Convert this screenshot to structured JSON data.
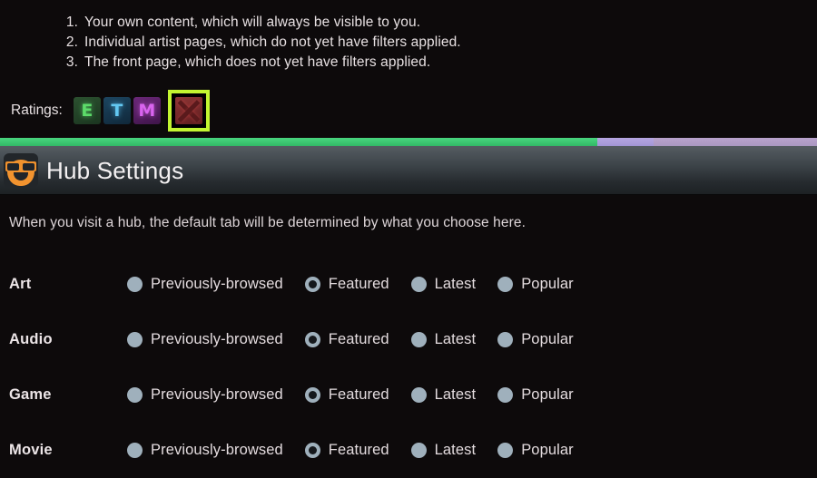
{
  "notice": {
    "items": [
      {
        "num": "1.",
        "text": "Your own content, which will always be visible to you."
      },
      {
        "num": "2.",
        "text": "Individual artist pages, which do not yet have filters applied."
      },
      {
        "num": "3.",
        "text": "The front page, which does not yet have filters applied."
      }
    ]
  },
  "ratings": {
    "label": "Ratings:",
    "chips": [
      {
        "letter": "E",
        "name": "rating-everyone",
        "selected": false
      },
      {
        "letter": "T",
        "name": "rating-teen",
        "selected": false
      },
      {
        "letter": "M",
        "name": "rating-mature",
        "selected": false
      },
      {
        "letter": "X",
        "name": "rating-adult",
        "selected": true
      }
    ],
    "highlight_color": "#c3f531"
  },
  "hub": {
    "accent": {
      "green": "#3dc872",
      "purple_light": "#ada0dc",
      "purple": "#b09bc5"
    },
    "title": "Hub Settings",
    "description": "When you visit a hub, the default tab will be determined by what you choose here.",
    "option_labels": [
      "Previously-browsed",
      "Featured",
      "Latest",
      "Popular"
    ],
    "rows": [
      {
        "label": "Art",
        "selected": "Featured"
      },
      {
        "label": "Audio",
        "selected": "Featured"
      },
      {
        "label": "Game",
        "selected": "Featured"
      },
      {
        "label": "Movie",
        "selected": "Featured"
      }
    ]
  }
}
